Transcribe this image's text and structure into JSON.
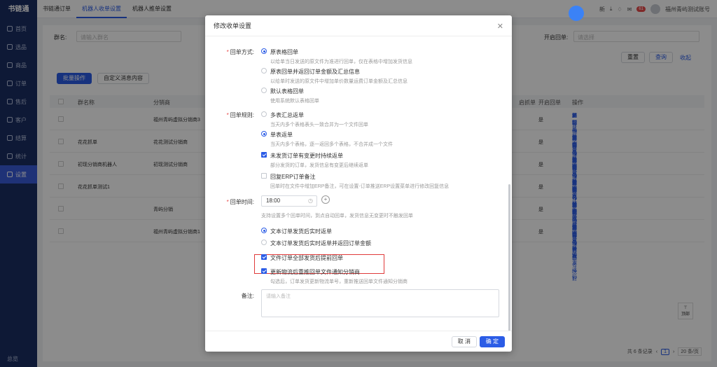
{
  "app": {
    "logo": "书链通",
    "footer": "总览"
  },
  "nav": [
    "首页",
    "选品",
    "商品",
    "订单",
    "售后",
    "客户",
    "统计",
    "设置"
  ],
  "nav_extra": "结算",
  "tabs": [
    "书链通订单",
    "机器人收单设置",
    "机器人推单设置"
  ],
  "topbar": {
    "new_label": "新",
    "badge": "61",
    "user": "福州青屿测试账号"
  },
  "filter": {
    "group_label": "群名:",
    "group_placeholder": "请输入群名",
    "auto_label": "开启回单:",
    "auto_placeholder": "请选择",
    "reset": "重置",
    "query": "查询",
    "collapse": "收起"
  },
  "toolbar": {
    "batch": "批量操作",
    "custom_msg": "自定义消息内容"
  },
  "table": {
    "headers": [
      "群名称",
      "分销商",
      "开启回单",
      "操作"
    ],
    "extra_header": "启抓单",
    "rows": [
      {
        "name": "",
        "distributor": "福州青屿虚拟分销商3",
        "on": "是",
        "ops": [
          "编辑",
          "复制机器人激活码",
          "群订单管理",
          "解除"
        ],
        "ops2": [
          "分销商品名映射",
          "操作日志"
        ]
      },
      {
        "name": "花花抓单",
        "distributor": "花花测试分销商",
        "on": "是",
        "ops": [
          "编辑",
          "复制机器人激活码",
          "群订单管理",
          "解除"
        ],
        "ops2": [
          "分销商品名映射",
          "操作日志"
        ]
      },
      {
        "name": "初现分销商机器人",
        "distributor": "初现测试分销商",
        "on": "是",
        "ops": [
          "编辑",
          "复制机器人激活码",
          "群订单管理",
          "解除"
        ],
        "ops2": [
          "分销商品名映射",
          "操作日志"
        ]
      },
      {
        "name": "花花抓单测试1",
        "distributor": "",
        "on": "是",
        "ops": [
          "编辑",
          "复制机器人激活码",
          "分销商品名映射",
          "删除"
        ],
        "ops2": [
          "操作日志"
        ]
      },
      {
        "name": "",
        "distributor": "青屿分销",
        "on": "是",
        "ops": [
          "编辑",
          "复制机器人激活码",
          "群订单管理",
          "解除"
        ],
        "ops2": [
          "分销商品名映射",
          "操作日志"
        ]
      },
      {
        "name": "",
        "distributor": "福州青屿虚拟分销商1",
        "on": "是",
        "ops": [
          "编辑",
          "复制机器人激活码",
          "群订单管理",
          "解除"
        ],
        "ops2": [
          "分销商品名映射",
          "操作日志"
        ]
      }
    ]
  },
  "pager": {
    "total": "共 6 条记录",
    "page": "1",
    "size": "20 条/页"
  },
  "back_top": "顶部",
  "modal": {
    "title": "修改收单设置",
    "mode_label": "回单方式:",
    "modes": [
      {
        "label": "原表格回单",
        "desc": "以给单当日发送的原文件为准进行回单，仅在表格中增加发货信息",
        "on": true
      },
      {
        "label": "原表回单并返回订单金额及汇总信息",
        "desc": "以给单时发送的原文件中增加单价数量运费订单金额及汇总信息",
        "on": false
      },
      {
        "label": "默认表格回单",
        "desc": "使用系统默认表格回单",
        "on": false
      }
    ],
    "rule_label": "回单规则:",
    "rules": [
      {
        "label": "多表汇总返单",
        "desc": "当天内多个表格表头一致合并为一个文件回单",
        "on": false
      },
      {
        "label": "单表返单",
        "desc": "当天内多个表格，逐一返回多个表格，不合并成一个文件",
        "on": true
      }
    ],
    "checks": [
      {
        "label": "未发货订单有变更时持续返单",
        "desc": "部分发货的订单，发货信息有变更后继续返单",
        "on": true
      },
      {
        "label": "回复ERP订单备注",
        "desc": "回单时在文件中增加ERP备注，可在设置-订单推送ERP设置菜单进行修改回复信息",
        "on": false
      }
    ],
    "time_label": "回单时间:",
    "time_value": "18:00",
    "time_hint": "支持设置多个回单时间，到点自动回单，发货信息无变更时不触发回单",
    "text_opts": [
      {
        "label": "文本订单发货后实时返单",
        "on": true
      },
      {
        "label": "文本订单发货后实时返单并返回订单金额",
        "on": false
      }
    ],
    "file_checks": [
      {
        "label": "文件订单全部发货后提前回单",
        "desc": "",
        "on": true
      },
      {
        "label": "更新物流后重推回单文件通知分销商",
        "desc": "勾选后，订单发货更新物流单号，重新推送回单文件通知分销商",
        "on": true
      }
    ],
    "remark_label": "备注:",
    "remark_placeholder": "请输入备注",
    "cancel": "取 消",
    "ok": "确 定"
  }
}
